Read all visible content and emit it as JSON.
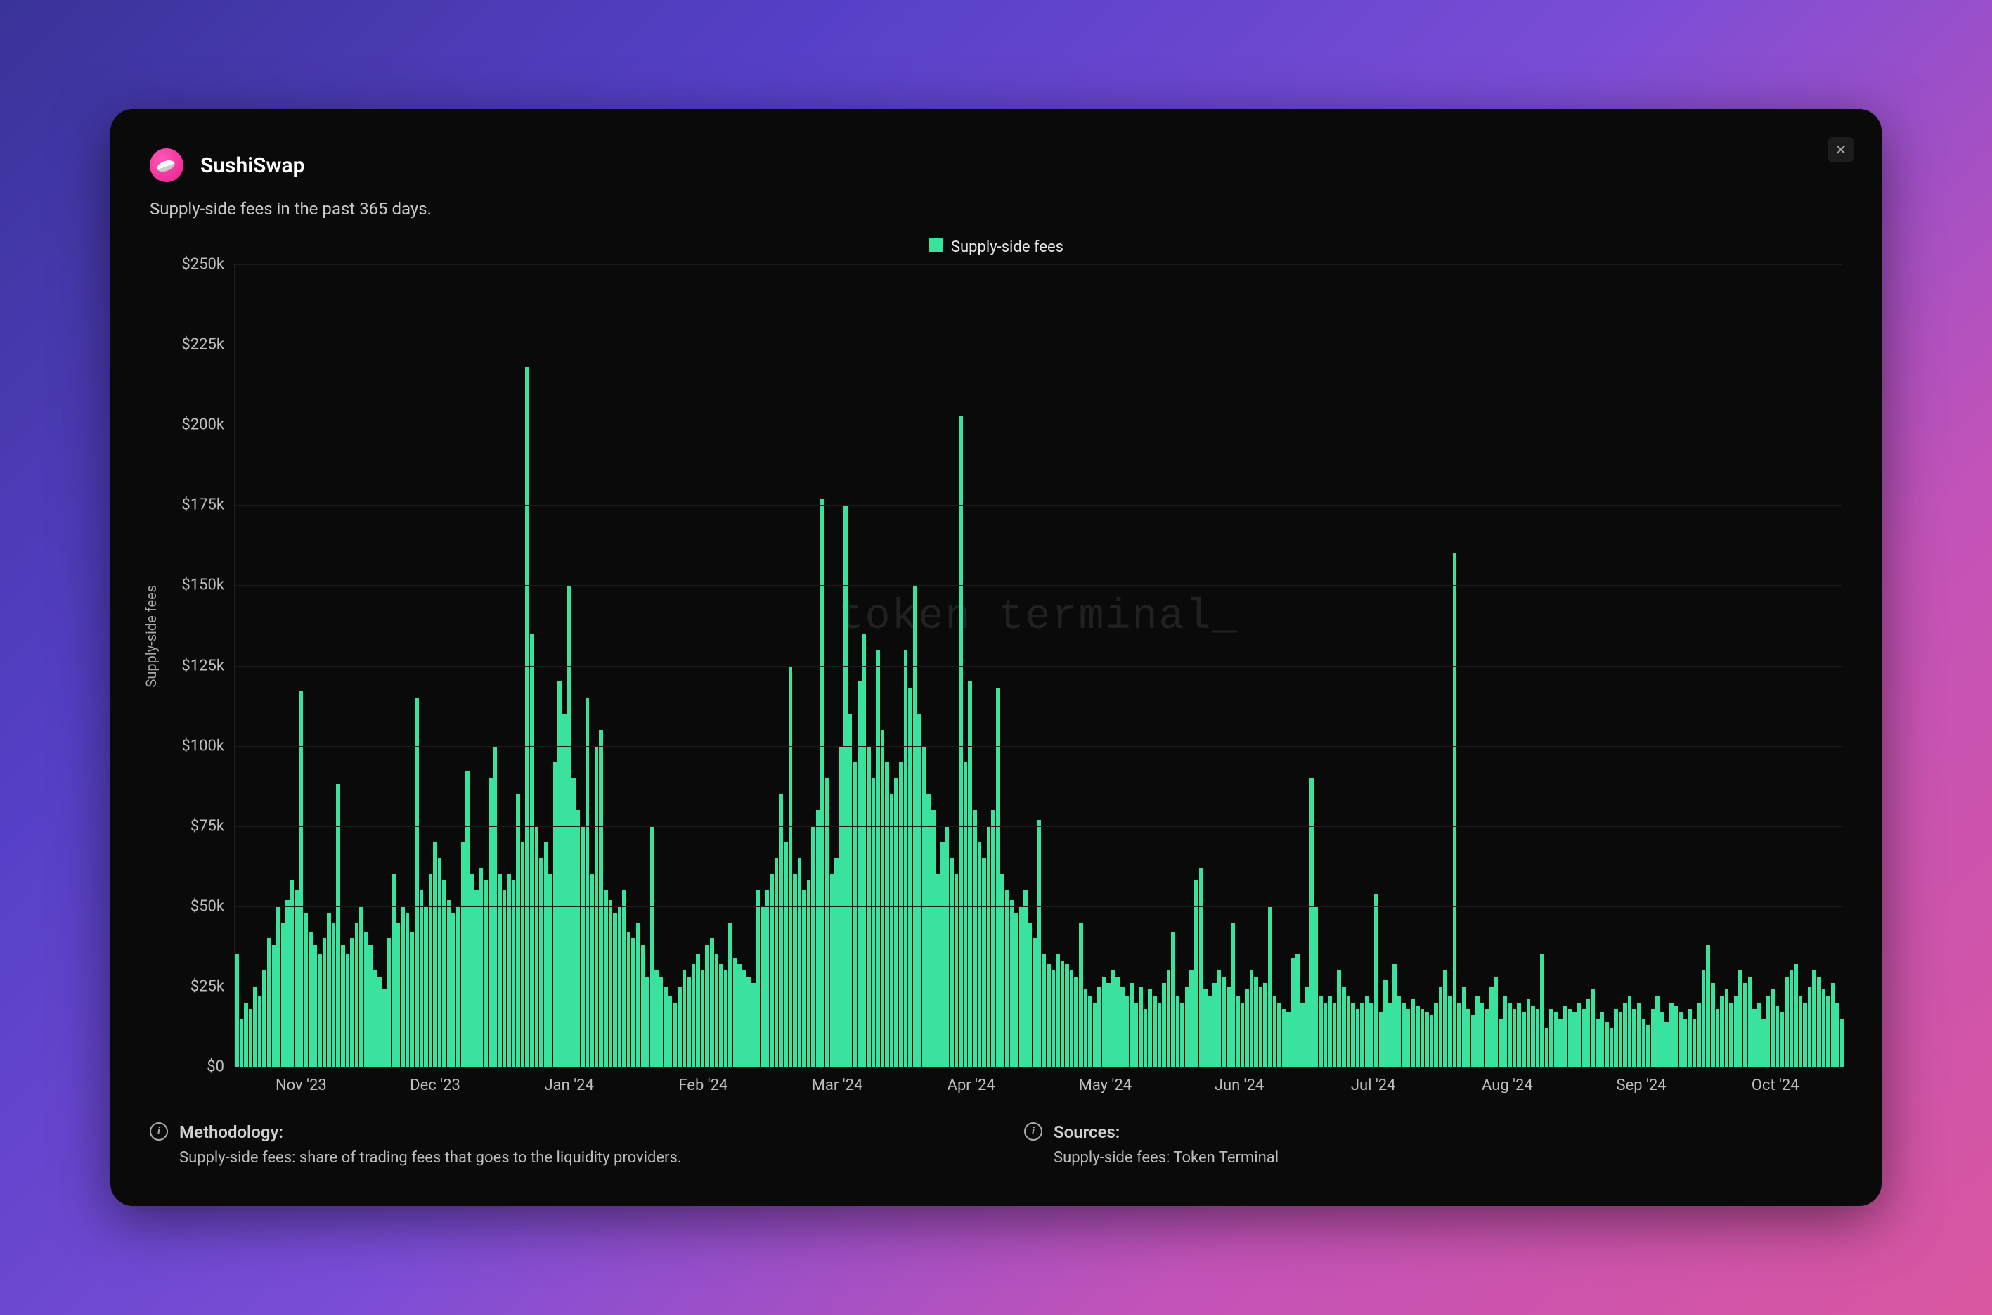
{
  "header": {
    "title": "SushiSwap",
    "subtitle": "Supply-side fees in the past 365 days."
  },
  "legend": {
    "label": "Supply-side fees"
  },
  "watermark": "token terminal_",
  "yaxis": {
    "title": "Supply-side fees",
    "ticks": [
      "$250k",
      "$225k",
      "$200k",
      "$175k",
      "$150k",
      "$125k",
      "$100k",
      "$75k",
      "$50k",
      "$25k",
      "$0"
    ]
  },
  "xaxis": {
    "ticks": [
      "Nov '23",
      "Dec '23",
      "Jan '24",
      "Feb '24",
      "Mar '24",
      "Apr '24",
      "May '24",
      "Jun '24",
      "Jul '24",
      "Aug '24",
      "Sep '24",
      "Oct '24"
    ]
  },
  "footer": {
    "methodology_title": "Methodology:",
    "methodology_body": "Supply-side fees: share of trading fees that goes to the liquidity providers.",
    "sources_title": "Sources:",
    "sources_body": "Supply-side fees: Token Terminal"
  },
  "chart_data": {
    "type": "bar",
    "title": "SushiSwap — Supply-side fees in the past 365 days",
    "ylabel": "Supply-side fees",
    "ylim": [
      0,
      250000
    ],
    "x_start": "Nov '23",
    "x_end": "Oct '24",
    "series": [
      {
        "name": "Supply-side fees",
        "color": "#39e29d",
        "values": [
          35000,
          15000,
          20000,
          18000,
          25000,
          22000,
          30000,
          40000,
          38000,
          50000,
          45000,
          52000,
          58000,
          55000,
          117000,
          48000,
          42000,
          38000,
          35000,
          40000,
          48000,
          45000,
          88000,
          38000,
          35000,
          40000,
          45000,
          50000,
          42000,
          38000,
          30000,
          28000,
          24000,
          40000,
          60000,
          45000,
          50000,
          48000,
          42000,
          115000,
          55000,
          50000,
          60000,
          70000,
          65000,
          58000,
          52000,
          48000,
          50000,
          70000,
          92000,
          60000,
          55000,
          62000,
          58000,
          90000,
          100000,
          60000,
          55000,
          60000,
          58000,
          85000,
          70000,
          218000,
          135000,
          75000,
          65000,
          70000,
          60000,
          95000,
          120000,
          110000,
          150000,
          90000,
          80000,
          75000,
          115000,
          60000,
          100000,
          105000,
          55000,
          52000,
          48000,
          50000,
          55000,
          42000,
          40000,
          45000,
          38000,
          28000,
          75000,
          30000,
          28000,
          25000,
          22000,
          20000,
          25000,
          30000,
          28000,
          32000,
          35000,
          30000,
          38000,
          40000,
          35000,
          32000,
          30000,
          45000,
          34000,
          32000,
          30000,
          28000,
          26000,
          55000,
          50000,
          55000,
          60000,
          65000,
          85000,
          70000,
          125000,
          60000,
          65000,
          55000,
          58000,
          75000,
          80000,
          177000,
          90000,
          60000,
          65000,
          100000,
          175000,
          110000,
          95000,
          120000,
          135000,
          100000,
          90000,
          130000,
          105000,
          95000,
          85000,
          90000,
          95000,
          130000,
          118000,
          150000,
          110000,
          100000,
          85000,
          80000,
          60000,
          70000,
          75000,
          65000,
          60000,
          203000,
          95000,
          120000,
          80000,
          70000,
          65000,
          75000,
          80000,
          118000,
          60000,
          55000,
          52000,
          48000,
          50000,
          55000,
          45000,
          40000,
          77000,
          35000,
          32000,
          30000,
          35000,
          33000,
          32000,
          30000,
          28000,
          45000,
          24000,
          22000,
          20000,
          25000,
          28000,
          26000,
          30000,
          28000,
          25000,
          22000,
          26000,
          20000,
          25000,
          18000,
          24000,
          22000,
          20000,
          26000,
          30000,
          42000,
          22000,
          20000,
          25000,
          30000,
          58000,
          62000,
          24000,
          22000,
          26000,
          30000,
          28000,
          25000,
          45000,
          22000,
          20000,
          24000,
          30000,
          28000,
          25000,
          26000,
          50000,
          22000,
          20000,
          18000,
          17000,
          34000,
          35000,
          20000,
          25000,
          90000,
          50000,
          22000,
          20000,
          22000,
          20000,
          30000,
          25000,
          22000,
          20000,
          18000,
          20000,
          22000,
          20000,
          54000,
          17000,
          27000,
          20000,
          32000,
          22000,
          20000,
          18000,
          21000,
          19000,
          18000,
          17000,
          16000,
          20000,
          25000,
          30000,
          22000,
          160000,
          20000,
          25000,
          18000,
          16000,
          22000,
          20000,
          18000,
          25000,
          28000,
          15000,
          22000,
          20000,
          18000,
          20000,
          17000,
          21000,
          19000,
          18000,
          35000,
          12000,
          18000,
          17000,
          15000,
          19000,
          18000,
          17000,
          20000,
          18000,
          21000,
          24000,
          15000,
          17000,
          14000,
          12000,
          18000,
          17000,
          20000,
          22000,
          18000,
          20000,
          15000,
          13000,
          18000,
          22000,
          17000,
          14000,
          20000,
          19000,
          17000,
          15000,
          18000,
          15000,
          20000,
          30000,
          38000,
          26000,
          18000,
          22000,
          24000,
          20000,
          22000,
          30000,
          26000,
          28000,
          18000,
          20000,
          15000,
          22000,
          24000,
          19000,
          17000,
          28000,
          30000,
          32000,
          22000,
          20000,
          25000,
          30000,
          28000,
          24000,
          22000,
          26000,
          20000,
          15000
        ]
      }
    ]
  }
}
